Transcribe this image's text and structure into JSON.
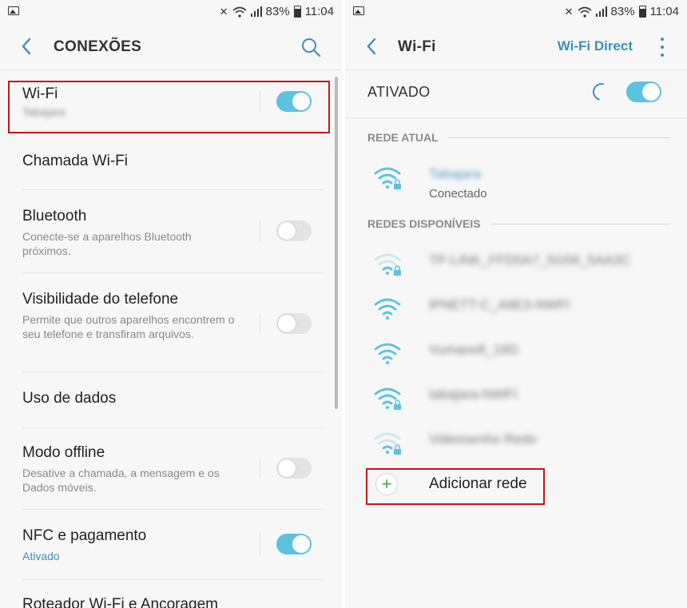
{
  "left": {
    "status": {
      "battery": "83%",
      "time": "11:04"
    },
    "header": {
      "title": "CONEXÕES"
    },
    "items": [
      {
        "title": "Wi-Fi",
        "subtitle": "Tabajara",
        "toggle": "on"
      },
      {
        "title": "Chamada Wi-Fi"
      },
      {
        "title": "Bluetooth",
        "subtitle": "Conecte-se a aparelhos Bluetooth próximos.",
        "toggle": "off"
      },
      {
        "title": "Visibilidade do telefone",
        "subtitle": "Permite que outros aparelhos encontrem o seu telefone e transfiram arquivos.",
        "toggle": "off"
      },
      {
        "title": "Uso de dados"
      },
      {
        "title": "Modo offline",
        "subtitle": "Desative a chamada, a mensagem e os Dados móveis.",
        "toggle": "off"
      },
      {
        "title": "NFC e pagamento",
        "subtitle": "Ativado",
        "toggle": "on"
      },
      {
        "title": "Roteador Wi-Fi e Ancoragem"
      }
    ]
  },
  "right": {
    "status": {
      "battery": "83%",
      "time": "11:04"
    },
    "header": {
      "title": "Wi-Fi",
      "wifi_direct": "Wi-Fi Direct"
    },
    "master": {
      "label": "ATIVADO",
      "toggle": "on"
    },
    "current_section": "REDE ATUAL",
    "current_network": {
      "name": "Tabajara",
      "status": "Conectado",
      "secured": true
    },
    "available_section": "REDES DISPONÍVEIS",
    "networks": [
      {
        "name": "TP-LINK_FFD0A7_5G56_5AA3C",
        "secured": true,
        "strength": "weak"
      },
      {
        "name": "iPNETT-C_A9E3-NWFI",
        "secured": false,
        "strength": "full"
      },
      {
        "name": "Vumanofi_18D",
        "secured": false,
        "strength": "full"
      },
      {
        "name": "tabajara-NWFI",
        "secured": true,
        "strength": "full"
      },
      {
        "name": "Videosenho Redo",
        "secured": true,
        "strength": "weak"
      }
    ],
    "add_network": "Adicionar rede"
  },
  "colors": {
    "accent": "#3c8fb8",
    "toggle_on": "#5cc3df",
    "highlight": "#c8151b",
    "add_green": "#3dad3b"
  }
}
